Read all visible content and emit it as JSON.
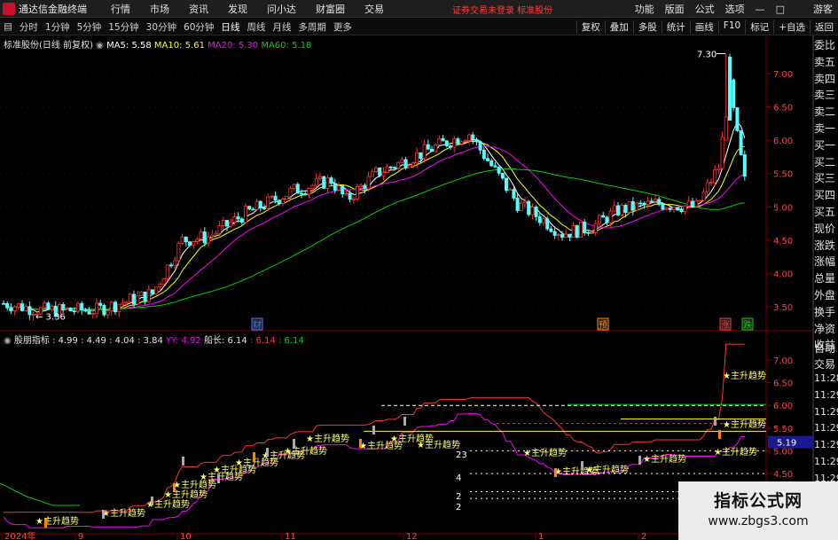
{
  "app": {
    "title": "通达信金融终端"
  },
  "menu": [
    "行情",
    "市场",
    "资讯",
    "发现",
    "问小达",
    "财富圈",
    "交易"
  ],
  "top_warning": "证券交易未登录  标准股份",
  "top_right": [
    "功能",
    "版面",
    "公式",
    "选项"
  ],
  "guest": "游客",
  "periods": [
    "分时",
    "1分钟",
    "5分钟",
    "15分钟",
    "30分钟",
    "60分钟",
    "日线",
    "周线",
    "月线",
    "多周期",
    "更多"
  ],
  "active_period": "日线",
  "tools": [
    "复权",
    "叠加",
    "多股",
    "统计",
    "画线",
    "F10",
    "标记",
    "+自选",
    "返回"
  ],
  "main_legend": {
    "stock": "标准股份(日线 前复权)",
    "ma5": "MA5: 5.58",
    "ma10": "MA10: 5.61",
    "ma20": "MA20: 5.30",
    "ma60": "MA60: 5.18"
  },
  "sub_legend": {
    "name": "股朋指标",
    "values": ": 4.99 : 4.49 : 4.04 : 3.84",
    "yy": "YY: 4.92",
    "chuanchang": "船长: 6.14",
    "v1": ": 6.14",
    "v2": ": 6.14"
  },
  "main_axis": [
    "7.00",
    "6.50",
    "6.00",
    "5.50",
    "5.00",
    "4.50",
    "4.00",
    "3.50"
  ],
  "sub_axis": [
    "7.00",
    "6.50",
    "6.00",
    "5.50",
    "5.00",
    "4.50"
  ],
  "sub_marker": "5.19",
  "peak_label": "7.30",
  "low_label": "3.36",
  "event_markers": [
    "财",
    "预",
    "涨",
    "跌"
  ],
  "x_axis": [
    "2024年",
    "9",
    "10",
    "11",
    "12",
    "1",
    "2"
  ],
  "signal_label": "主升趋势",
  "signal_nums": [
    "23",
    "4",
    "2",
    "2"
  ],
  "right_panel": [
    "委比",
    "卖五",
    "卖四",
    "卖三",
    "卖二",
    "卖一",
    "买一",
    "买二",
    "买三",
    "买四",
    "买五",
    "现价",
    "涨跌",
    "涨幅",
    "总量",
    "外盘",
    "换手",
    "净资",
    "收益"
  ],
  "right_panel2": [
    "自动",
    "交易"
  ],
  "times": [
    "11:28",
    "11:29",
    "11:29",
    "11:29",
    "11:29",
    "11:29",
    "11:29",
    "11:29",
    "11:29",
    "11:29"
  ],
  "watermark": {
    "line1": "指标公式网",
    "line2": "www.zbgs3.com"
  },
  "colors": {
    "up": "#ff3333",
    "down": "#54ffff",
    "ma5": "#ffffff",
    "ma10": "#ffff00",
    "ma20": "#ff00ff",
    "ma60": "#00d000",
    "grid": "#800000"
  }
}
